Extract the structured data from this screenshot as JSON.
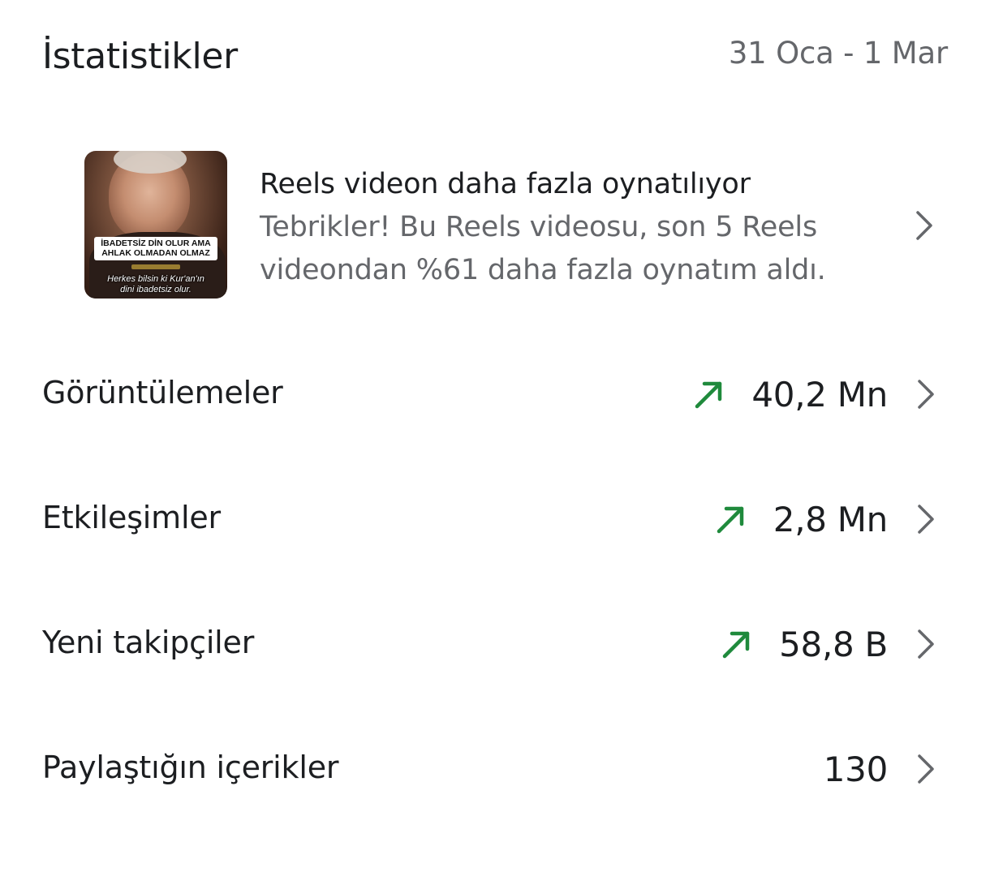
{
  "header": {
    "title": "İstatistikler",
    "date_range": "31 Oca - 1 Mar"
  },
  "insight": {
    "title": "Reels videon daha fazla oynatılıyor",
    "body_line1": "Tebrikler! Bu Reels videosu, son 5 Reels",
    "body_line2": "videondan %61 daha fazla oynatım aldı.",
    "thumbnail": {
      "caption_line1": "İBADETSİZ DİN OLUR AMA",
      "caption_line2": "AHLAK OLMADAN OLMAZ",
      "subtitle_line1": "Herkes bilsin ki Kur'an'ın",
      "subtitle_line2": "dini ibadetsiz olur."
    },
    "chevron_icon": "chevron-right-icon"
  },
  "metrics": [
    {
      "label": "Görüntülemeler",
      "value": "40,2 Mn",
      "trend": "up",
      "trend_icon": "trend-up-icon"
    },
    {
      "label": "Etkileşimler",
      "value": "2,8 Mn",
      "trend": "up",
      "trend_icon": "trend-up-icon"
    },
    {
      "label": "Yeni takipçiler",
      "value": "58,8 B",
      "trend": "up",
      "trend_icon": "trend-up-icon"
    },
    {
      "label": "Paylaştığın içerikler",
      "value": "130",
      "trend": "none"
    }
  ],
  "colors": {
    "primary_text": "#1c1e21",
    "secondary_text": "#65676b",
    "trend_up": "#1f8a3c",
    "chevron": "#65676b"
  }
}
